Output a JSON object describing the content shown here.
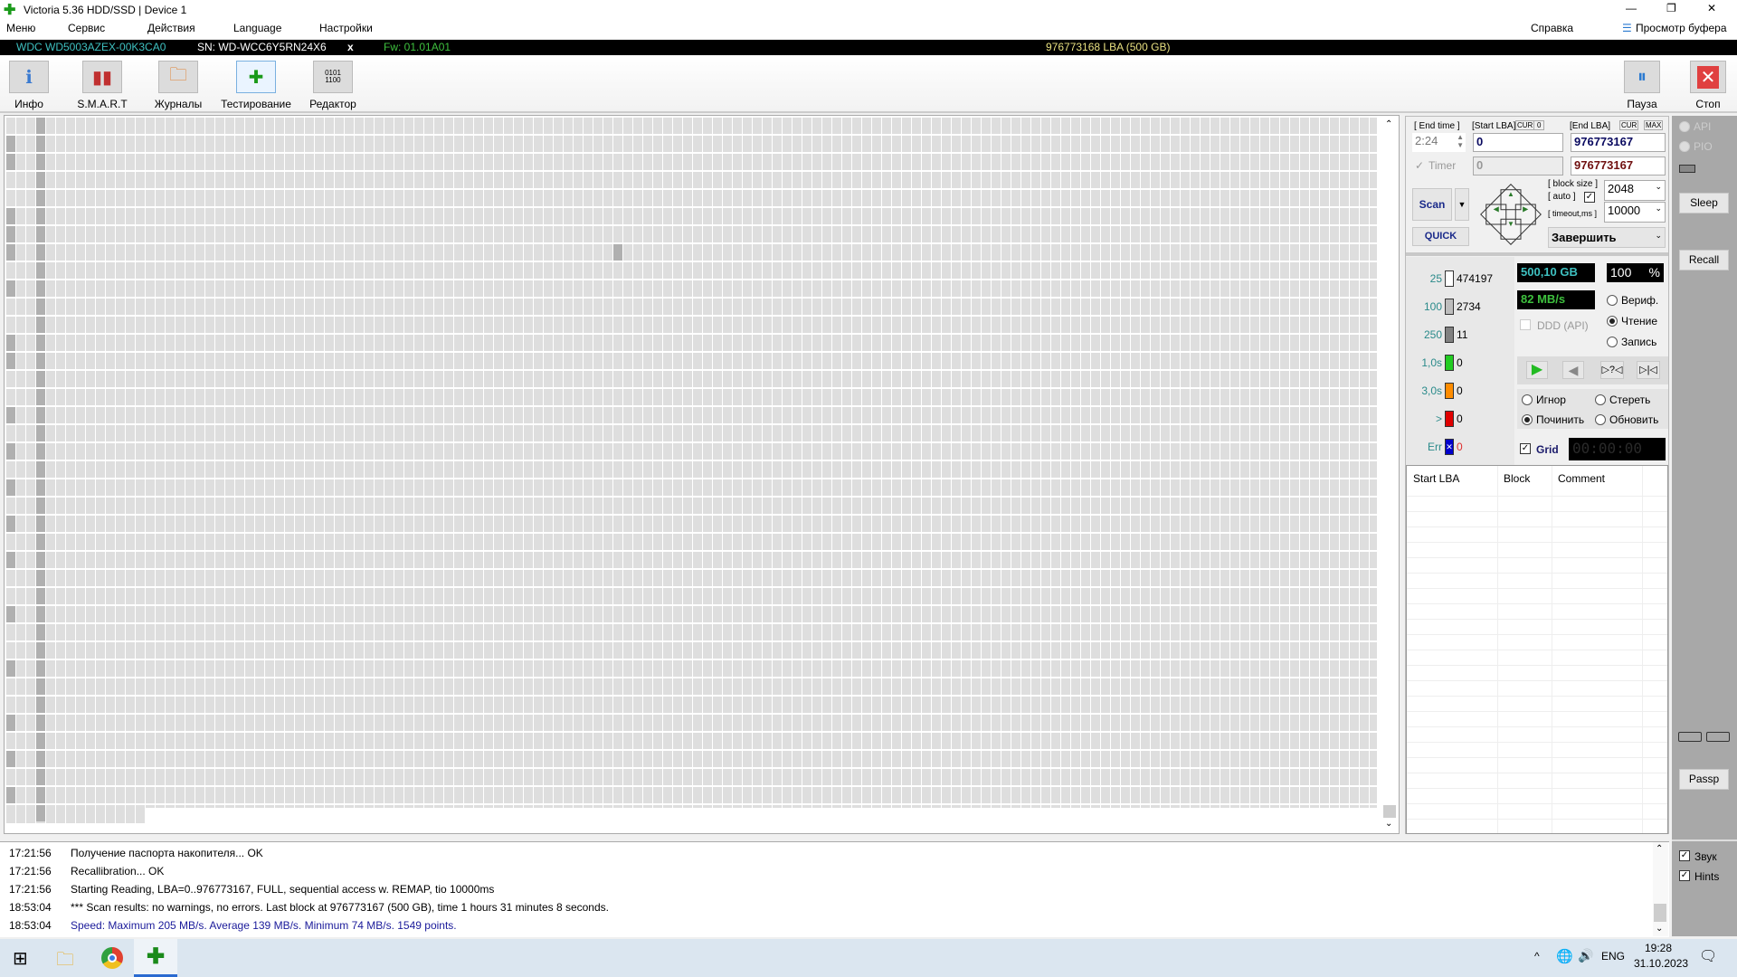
{
  "window": {
    "title": "Victoria 5.36 HDD/SSD | Device 1",
    "controls": [
      "—",
      "❐",
      "✕"
    ]
  },
  "menu": {
    "items": [
      "Меню",
      "Сервис",
      "Действия",
      "Language",
      "Настройки"
    ],
    "help": "Справка",
    "buffer": "Просмотр буфера"
  },
  "device": {
    "model": "WDC WD5003AZEX-00K3CA0",
    "serial": "SN: WD-WCC6Y5RN24X6",
    "close": "x",
    "firmware": "Fw: 01.01A01",
    "capacity": "976773168 LBA (500 GB)"
  },
  "toolbar": {
    "items": [
      {
        "label": "Инфо",
        "icon": "info-icon"
      },
      {
        "label": "S.M.A.R.T",
        "icon": "smart-icon"
      },
      {
        "label": "Журналы",
        "icon": "logs-icon"
      },
      {
        "label": "Тестирование",
        "icon": "test-icon"
      },
      {
        "label": "Редактор",
        "icon": "editor-icon"
      }
    ],
    "pause": "Пауза",
    "stop": "Стоп"
  },
  "scan": {
    "end_time_label": "[ End time ]",
    "start_lba_label": "[Start LBA]",
    "cur": "CUR",
    "zero": "0",
    "end_lba_label": "[End LBA]",
    "max": "MAX",
    "end_time": "2:24",
    "start_lba": "0",
    "end_lba": "976773167",
    "timer_label": "Timer",
    "timer_value": "0",
    "end_lba2": "976773167",
    "scan_button": "Scan",
    "quick_button": "QUICK",
    "block_size_label": "[ block size ]",
    "auto_label": "[ auto ]",
    "timeout_label": "[ timeout,ms ]",
    "block_size": "2048",
    "timeout": "10000",
    "finish_action": "Завершить"
  },
  "stats": [
    {
      "label": "25",
      "value": "474197",
      "color": "#ffffff"
    },
    {
      "label": "100",
      "value": "2734",
      "color": "#bdbdbd"
    },
    {
      "label": "250",
      "value": "11",
      "color": "#808080"
    },
    {
      "label": "1,0s",
      "value": "0",
      "color": "#22cc22"
    },
    {
      "label": "3,0s",
      "value": "0",
      "color": "#ff8c00"
    },
    {
      "label": ">",
      "value": "0",
      "color": "#e00000"
    },
    {
      "label": "Err",
      "value": "0",
      "color": "#0000cc"
    }
  ],
  "status": {
    "size": "500,10 GB",
    "percent": "100",
    "percent_sign": "%",
    "speed": "82 MB/s",
    "ddd": "DDD (API)",
    "grid": "Grid",
    "timer": "00:00:00"
  },
  "mode": {
    "options": [
      "Вериф.",
      "Чтение",
      "Запись"
    ],
    "selected": "Чтение"
  },
  "action": {
    "options": [
      "Игнор",
      "Стереть",
      "Починить",
      "Обновить"
    ],
    "selected": "Починить"
  },
  "table": {
    "columns": [
      "Start LBA",
      "Block",
      "Comment"
    ]
  },
  "side": {
    "api": "API",
    "pio": "PIO",
    "sleep": "Sleep",
    "recall": "Recall",
    "passp": "Passp",
    "sound": "Звук",
    "hints": "Hints"
  },
  "log": [
    {
      "time": "17:21:56",
      "text": "Получение паспорта накопителя... OK"
    },
    {
      "time": "17:21:56",
      "text": "Recallibration... OK"
    },
    {
      "time": "17:21:56",
      "text": "Starting Reading, LBA=0..976773167, FULL, sequential access w. REMAP, tio 10000ms"
    },
    {
      "time": "18:53:04",
      "text": "*** Scan results: no warnings, no errors. Last block at 976773167 (500 GB), time 1 hours 31 minutes 8 seconds."
    },
    {
      "time": "18:53:04",
      "text": "Speed: Maximum 205 MB/s. Average 139 MB/s. Minimum 74 MB/s. 1549 points.",
      "color": "#1a1a9a"
    }
  ],
  "taskbar": {
    "lang": "ENG",
    "time": "19:28",
    "date": "31.10.2023"
  }
}
